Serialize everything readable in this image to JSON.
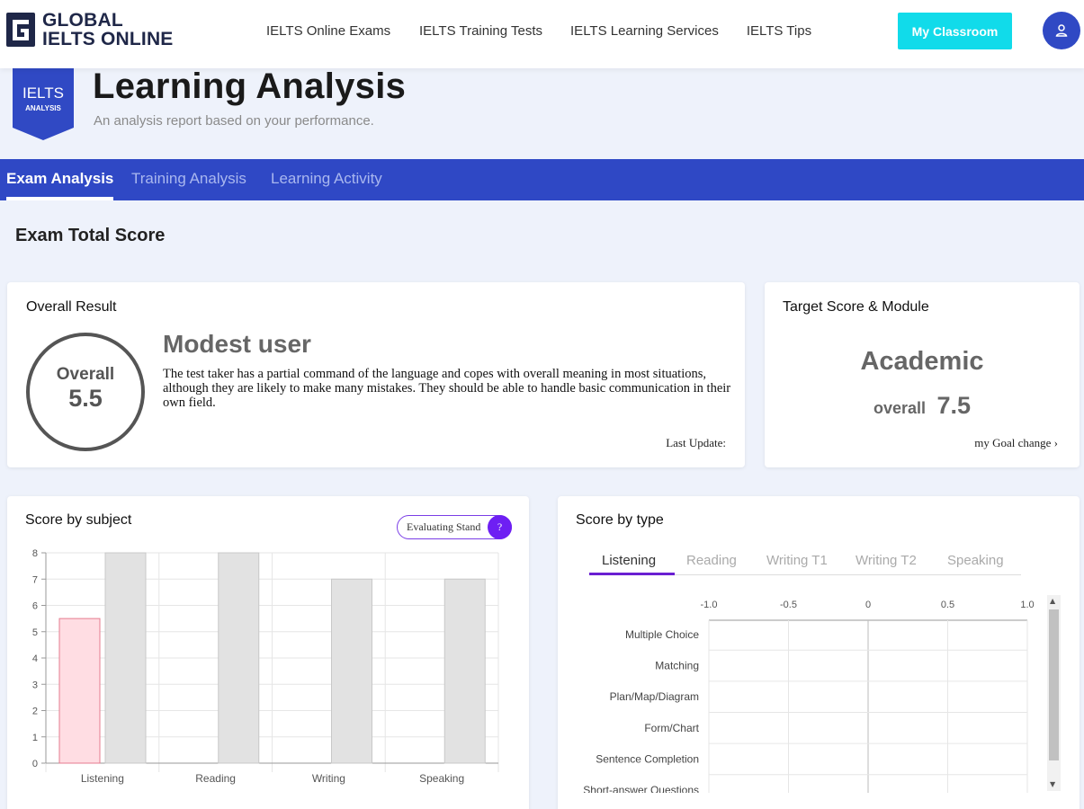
{
  "brand": {
    "line1": "GLOBAL",
    "line2": "IELTS ONLINE",
    "color": "#1f2748"
  },
  "nav": {
    "links": [
      "IELTS Online Exams",
      "IELTS Training Tests",
      "IELTS Learning Services",
      "IELTS Tips"
    ],
    "classroom_label": "My Classroom",
    "classroom_color": "#11dbea",
    "avatar_icon": "user-icon"
  },
  "header": {
    "badge_top": "IELTS",
    "badge_bottom": "ANALYSIS",
    "title": "Learning Analysis",
    "subtitle": "An analysis report based on your performance."
  },
  "tabs": {
    "items": [
      "Exam Analysis",
      "Training Analysis",
      "Learning Activity"
    ],
    "active": "Exam Analysis",
    "bar_color": "#2f48c5"
  },
  "section_title": "Exam Total Score",
  "overall_result": {
    "title": "Overall Result",
    "ring_label": "Overall",
    "score": "5.5",
    "level": "Modest user",
    "description": "The test taker has a partial command of the language and copes with overall meaning in most situations, although they are likely to make many mistakes. They should be able to handle basic communication in their own field.",
    "last_update": "Last Update:"
  },
  "target": {
    "title": "Target Score & Module",
    "module": "Academic",
    "overall_label": "overall",
    "overall_value": "7.5",
    "goal_change": "my Goal change ›"
  },
  "score_by_subject": {
    "title": "Score by subject",
    "eval_label": "Evaluating Stand",
    "eval_icon": "?"
  },
  "score_by_type": {
    "title": "Score by type",
    "tabs": [
      "Listening",
      "Reading",
      "Writing T1",
      "Writing T2",
      "Speaking"
    ],
    "active": "Listening"
  },
  "chart_data": [
    {
      "type": "bar",
      "categories": [
        "Listening",
        "Reading",
        "Writing",
        "Speaking"
      ],
      "series": [
        {
          "values": [
            5.5,
            null,
            null,
            null
          ],
          "color": "#ffdde3",
          "stroke": "#e57b8f"
        },
        {
          "values": [
            8,
            8,
            7,
            7
          ],
          "color": "#e2e2e2",
          "stroke": "#c8c8c8"
        }
      ],
      "ylim": [
        0,
        8
      ],
      "yticks": [
        0,
        1,
        2,
        3,
        4,
        5,
        6,
        7,
        8
      ],
      "grid": true
    },
    {
      "type": "bar",
      "orientation": "horizontal",
      "categories": [
        "Multiple Choice",
        "Matching",
        "Plan/Map/Diagram",
        "Form/Chart",
        "Sentence Completion",
        "Short-answer Questions"
      ],
      "series": [],
      "xlim": [
        -1.0,
        1.0
      ],
      "xticks": [
        "-1.0",
        "-0.5",
        "0",
        "0.5",
        "1.0"
      ],
      "grid": true
    }
  ]
}
